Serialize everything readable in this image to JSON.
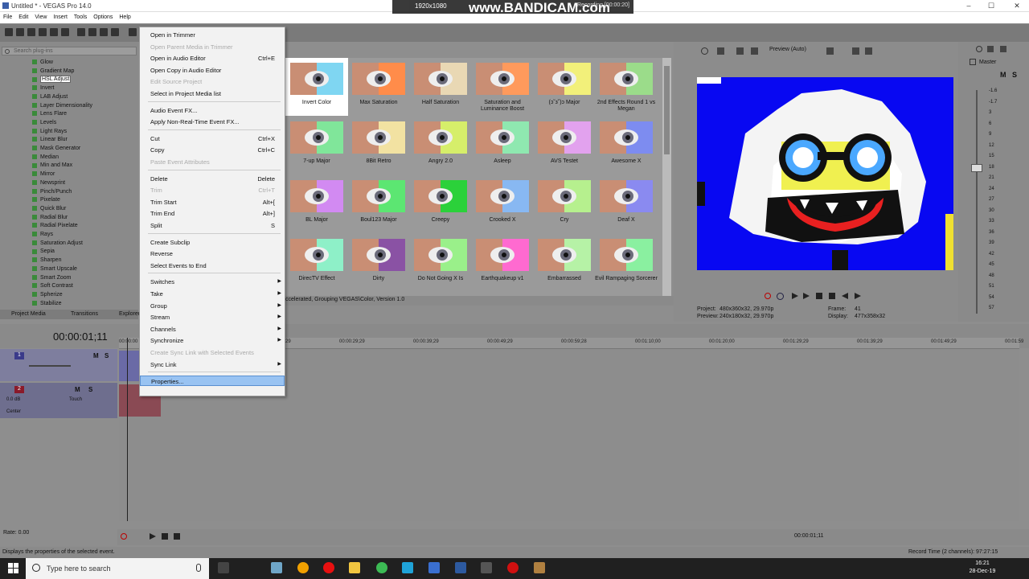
{
  "window": {
    "title": "Untitled * - VEGAS Pro 14.0",
    "minimize": "–",
    "maximize": "☐",
    "close": "✕"
  },
  "menubar": [
    "File",
    "Edit",
    "View",
    "Insert",
    "Tools",
    "Options",
    "Help"
  ],
  "bandicam": {
    "resolution": "1920x1080",
    "logo": "www.BANDICAM.com",
    "recording": "Recording [00:00:20]"
  },
  "left_panel": {
    "search_placeholder": "Search plug-ins",
    "plugins": [
      "Glow",
      "Gradient Map",
      "HSL Adjust",
      "Invert",
      "LAB Adjust",
      "Layer Dimensionality",
      "Lens Flare",
      "Levels",
      "Light Rays",
      "Linear Blur",
      "Mask Generator",
      "Median",
      "Min and Max",
      "Mirror",
      "Newsprint",
      "Pinch/Punch",
      "Pixelate",
      "Quick Blur",
      "Radial Blur",
      "Radial Pixelate",
      "Rays",
      "Saturation Adjust",
      "Sepia",
      "Sharpen",
      "Smart Upscale",
      "Smart Zoom",
      "Soft Contrast",
      "Spherize",
      "Stabilize"
    ],
    "selected_plugin": "HSL Adjust",
    "tabs": [
      "Project Media",
      "Transitions",
      "Explorer"
    ]
  },
  "fx_presets": [
    {
      "label": "Invert Color",
      "tint": "#7fd6f2"
    },
    {
      "label": "Max Saturation",
      "tint": "#ff8c4a"
    },
    {
      "label": "Half Saturation",
      "tint": "#e9d8b4"
    },
    {
      "label": "Saturation and Luminance Boost",
      "tint": "#ff9a5c"
    },
    {
      "label": "(ɔ˘з˘)ɔ Major",
      "tint": "#f2f07a"
    },
    {
      "label": "2nd Effects Round 1 vs Megan",
      "tint": "#9bdc8a"
    },
    {
      "label": "7-up Major",
      "tint": "#80e69a"
    },
    {
      "label": "8Bit Retro",
      "tint": "#f2e2a2"
    },
    {
      "label": "Angry 2.0",
      "tint": "#d6ee6a"
    },
    {
      "label": "Asleep",
      "tint": "#8fe8b0"
    },
    {
      "label": "AVS Testet",
      "tint": "#e2a2ee"
    },
    {
      "label": "Awesome X",
      "tint": "#7d8cf0"
    },
    {
      "label": "BL Major",
      "tint": "#d28af2"
    },
    {
      "label": "Boul123 Major",
      "tint": "#5ce672"
    },
    {
      "label": "Creepy",
      "tint": "#2bd13a"
    },
    {
      "label": "Crooked X",
      "tint": "#88b8f2"
    },
    {
      "label": "Cry",
      "tint": "#b6f08e"
    },
    {
      "label": "Deaf X",
      "tint": "#8a8af0"
    },
    {
      "label": "DirecTV Effect",
      "tint": "#8ef0c8"
    },
    {
      "label": "Dirty",
      "tint": "#8a52a4"
    },
    {
      "label": "Do Not Going X Is",
      "tint": "#9af08a"
    },
    {
      "label": "Earthquakeup v1",
      "tint": "#ff6ad0"
    },
    {
      "label": "Embarrassed",
      "tint": "#b6f2a6"
    },
    {
      "label": "Evil Rampaging Sorcerer",
      "tint": "#8af0a0"
    }
  ],
  "fx_status": "ccelerated, Grouping VEGAS\\Color, Version 1.0",
  "preview": {
    "mode": "Preview (Auto)",
    "project_label": "Project:",
    "project_value": "480x360x32, 29.970p",
    "preview_label": "Preview:",
    "preview_value": "240x180x32, 29.970p",
    "frame_label": "Frame:",
    "frame_value": "41",
    "display_label": "Display:",
    "display_value": "477x358x32"
  },
  "master": {
    "label": "Master",
    "scale": [
      "-1.6",
      "-1.7",
      "3",
      "6",
      "9",
      "12",
      "15",
      "18",
      "21",
      "24",
      "27",
      "30",
      "33",
      "36",
      "39",
      "42",
      "45",
      "48",
      "51",
      "54",
      "57"
    ]
  },
  "timeline": {
    "timecode": "00:00:01;11",
    "ruler": [
      "00:00:00",
      "00:00:19;29",
      "00:00:29;29",
      "00:00:39;29",
      "00:00:49;29",
      "00:00:59;28",
      "00:01:10;00",
      "00:01:20;00",
      "00:01:29;29",
      "00:01:39;29",
      "00:01:49;29",
      "00:01:59"
    ],
    "track1_num": "1",
    "track2_num": "2",
    "track2_vol": "0.0 dB",
    "track2_touch": "Touch",
    "track2_pan": "Center",
    "rate": "Rate: 0.00",
    "end_time": "00:00:01;11"
  },
  "context_menu": {
    "items": [
      {
        "label": "Open in Trimmer",
        "shortcut": "",
        "disabled": false
      },
      {
        "label": "Open Parent Media in Trimmer",
        "shortcut": "",
        "disabled": true
      },
      {
        "label": "Open in Audio Editor",
        "shortcut": "Ctrl+E",
        "disabled": false
      },
      {
        "label": "Open Copy in Audio Editor",
        "shortcut": "",
        "disabled": false
      },
      {
        "label": "Edit Source Project",
        "shortcut": "",
        "disabled": true
      },
      {
        "label": "Select in Project Media list",
        "shortcut": "",
        "disabled": false
      },
      {
        "label": "Audio Event FX...",
        "shortcut": "",
        "disabled": false
      },
      {
        "label": "Apply Non-Real-Time Event FX...",
        "shortcut": "",
        "disabled": false
      },
      {
        "label": "Cut",
        "shortcut": "Ctrl+X",
        "disabled": false
      },
      {
        "label": "Copy",
        "shortcut": "Ctrl+C",
        "disabled": false
      },
      {
        "label": "Paste Event Attributes",
        "shortcut": "",
        "disabled": true
      },
      {
        "label": "Delete",
        "shortcut": "Delete",
        "disabled": false
      },
      {
        "label": "Trim",
        "shortcut": "Ctrl+T",
        "disabled": true
      },
      {
        "label": "Trim Start",
        "shortcut": "Alt+[",
        "disabled": false
      },
      {
        "label": "Trim End",
        "shortcut": "Alt+]",
        "disabled": false
      },
      {
        "label": "Split",
        "shortcut": "S",
        "disabled": false
      },
      {
        "label": "Create Subclip",
        "shortcut": "",
        "disabled": false
      },
      {
        "label": "Reverse",
        "shortcut": "",
        "disabled": false
      },
      {
        "label": "Select Events to End",
        "shortcut": "",
        "disabled": false
      },
      {
        "label": "Switches",
        "shortcut": "",
        "disabled": false
      },
      {
        "label": "Take",
        "shortcut": "",
        "disabled": false
      },
      {
        "label": "Group",
        "shortcut": "",
        "disabled": false
      },
      {
        "label": "Stream",
        "shortcut": "",
        "disabled": false
      },
      {
        "label": "Channels",
        "shortcut": "",
        "disabled": false
      },
      {
        "label": "Synchronize",
        "shortcut": "",
        "disabled": false
      },
      {
        "label": "Create Sync Link with Selected Events",
        "shortcut": "",
        "disabled": true
      },
      {
        "label": "Sync Link",
        "shortcut": "",
        "disabled": false
      },
      {
        "label": "Properties...",
        "shortcut": "",
        "disabled": false
      }
    ]
  },
  "statusbar": {
    "message": "Displays the properties of the selected event.",
    "record_time": "Record Time (2 channels): 97:27:15"
  },
  "taskbar": {
    "search_placeholder": "Type here to search",
    "time": "16:21",
    "date": "28-Dec-19"
  }
}
